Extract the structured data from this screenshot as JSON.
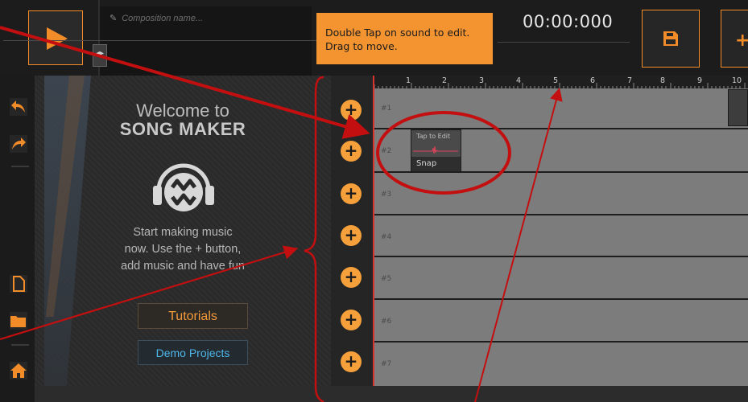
{
  "app": {
    "composition_placeholder": "Composition name...",
    "timer": "00:00:000",
    "tooltip": {
      "line1": "Double Tap on sound to edit.",
      "line2": "Drag to move."
    }
  },
  "icons": {
    "play": "play-icon",
    "save": "save-icon",
    "undo": "undo-icon",
    "redo": "redo-icon",
    "new_file": "new-file-icon",
    "open_folder": "folder-icon",
    "home": "home-icon",
    "pencil": "pencil-icon",
    "add": "plus-icon",
    "logo": "headphones-logo"
  },
  "welcome": {
    "title_line1": "Welcome to",
    "title_line2": "SONG MAKER",
    "text_line1": "Start making music",
    "text_line2": "now. Use the + button,",
    "text_line3": "add music and have fun",
    "tutorials_label": "Tutorials",
    "demo_label": "Demo Projects"
  },
  "ruler": {
    "ticks": [
      "1",
      "2",
      "3",
      "4",
      "5",
      "6",
      "7",
      "8",
      "9",
      "10"
    ]
  },
  "tracks": [
    "#1",
    "#2",
    "#3",
    "#4",
    "#5",
    "#6",
    "#7"
  ],
  "clip": {
    "title": "Tap to Edit",
    "name": "Snap"
  },
  "colors": {
    "accent_orange": "#f28c28",
    "tooltip_bg": "#f39431",
    "demo_blue": "#4fb6ea",
    "playhead_red": "#d9342c",
    "annotation_red": "#c30f0f"
  }
}
